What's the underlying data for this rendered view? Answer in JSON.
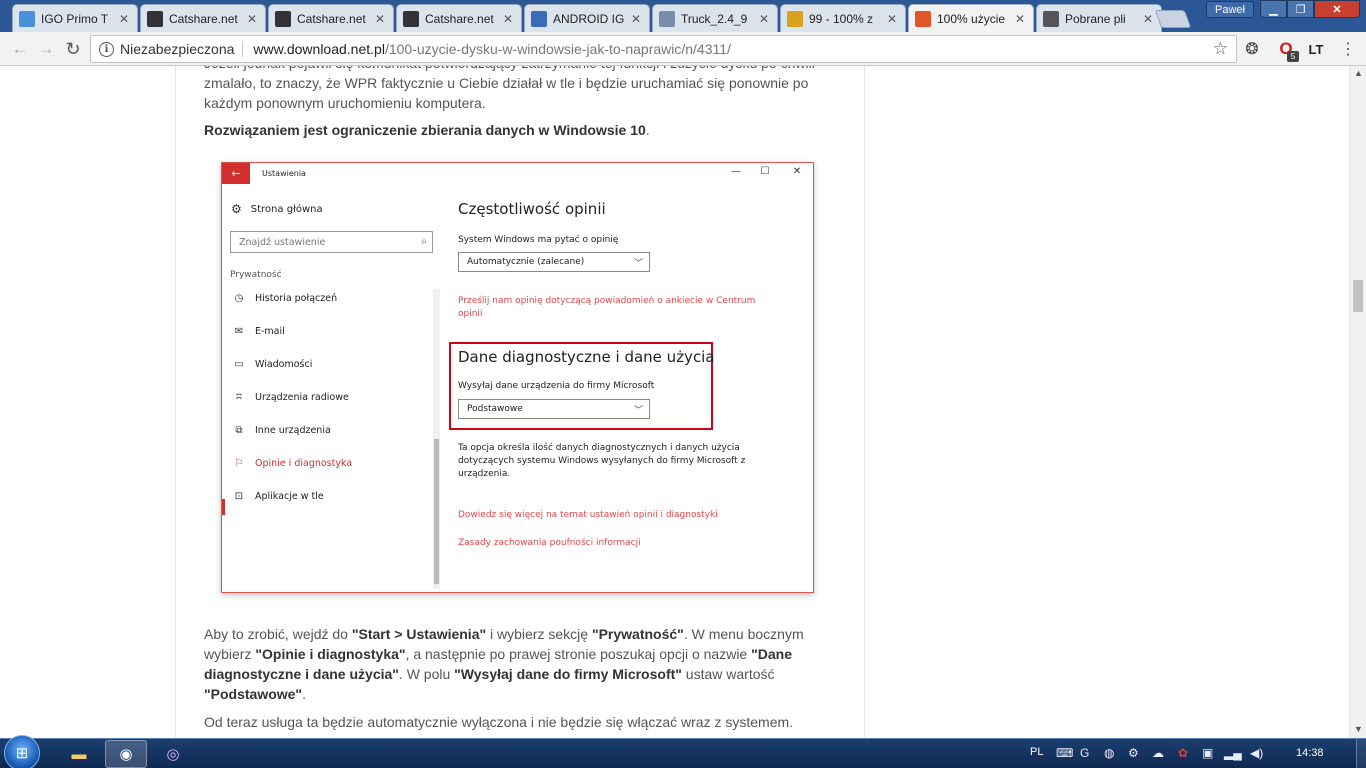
{
  "browser": {
    "tabs": [
      {
        "label": "IGO Primo T",
        "favicon": "igo-icon",
        "color": "#4a90d9"
      },
      {
        "label": "Catshare.net",
        "favicon": "cat-icon",
        "color": "#333333"
      },
      {
        "label": "Catshare.net",
        "favicon": "cat-icon",
        "color": "#333333"
      },
      {
        "label": "Catshare.net",
        "favicon": "cat-icon",
        "color": "#333333"
      },
      {
        "label": "ANDROID IG",
        "favicon": "globe-icon",
        "color": "#3b6cb7"
      },
      {
        "label": "Truck_2.4_9",
        "favicon": "doc-icon",
        "color": "#7a8da8"
      },
      {
        "label": "99 - 100% z",
        "favicon": "bulb-icon",
        "color": "#d9a21e"
      },
      {
        "label": "100% użycie",
        "favicon": "dn-icon",
        "color": "#e2552a",
        "active": true
      },
      {
        "label": "Pobrane pli",
        "favicon": "download-icon",
        "color": "#555555"
      }
    ],
    "user": "Paweł",
    "security_label": "Niezabezpieczona",
    "url_host": "www.download.net.pl",
    "url_path": "/100-uzycie-dysku-w-windowsie-jak-to-naprawic/n/4311/",
    "opera_badge": "5",
    "lt_label": "LT"
  },
  "article": {
    "para1": "Jeżeli jednak pojawił się komunikat potwierdzający zatrzymanie tej funkcji i zużycie dysku po chwili zmalało, to znaczy, że WPR faktycznie u Ciebie działał w tle i będzie uruchamiać się ponownie po każdym ponownym uruchomieniu komputera.",
    "para2": "Rozwiązaniem jest ograniczenie zbierania danych w Windowsie 10",
    "para3": [
      {
        "t": "Aby to zrobić, wejdź do ",
        "b": false
      },
      {
        "t": "\"Start > Ustawienia\"",
        "b": true
      },
      {
        "t": " i wybierz sekcję ",
        "b": false
      },
      {
        "t": "\"Prywatność\"",
        "b": true
      },
      {
        "t": ". W menu bocznym wybierz ",
        "b": false
      },
      {
        "t": "\"Opinie i diagnostyka\"",
        "b": true
      },
      {
        "t": ", a następnie po prawej stronie poszukaj opcji o nazwie ",
        "b": false
      },
      {
        "t": "\"Dane diagnostyczne i dane użycia\"",
        "b": true
      },
      {
        "t": ". W polu ",
        "b": false
      },
      {
        "t": "\"Wysyłaj dane do firmy Microsoft\"",
        "b": true
      },
      {
        "t": " ustaw wartość ",
        "b": false
      },
      {
        "t": "\"Podstawowe\"",
        "b": true
      },
      {
        "t": ".",
        "b": false
      }
    ],
    "para4": "Od teraz usługa ta będzie automatycznie wyłączona i nie będzie się włączać wraz z systemem."
  },
  "settings": {
    "title": "Ustawienia",
    "home": "Strona główna",
    "search_placeholder": "Znajdź ustawienie",
    "group": "Prywatność",
    "nav_items": [
      {
        "label": "Historia połączeń",
        "icon": "history-icon",
        "glyph": "◷"
      },
      {
        "label": "E-mail",
        "icon": "mail-icon",
        "glyph": "✉"
      },
      {
        "label": "Wiadomości",
        "icon": "chat-icon",
        "glyph": "▭"
      },
      {
        "label": "Urządzenia radiowe",
        "icon": "radio-icon",
        "glyph": "ʭ"
      },
      {
        "label": "Inne urządzenia",
        "icon": "devices-icon",
        "glyph": "⧉"
      },
      {
        "label": "Opinie i diagnostyka",
        "icon": "feedback-icon",
        "glyph": "⚐",
        "active": true
      },
      {
        "label": "Aplikacje w tle",
        "icon": "apps-icon",
        "glyph": "⊡"
      }
    ],
    "freq_heading": "Częstotliwość opinii",
    "freq_label": "System Windows ma pytać o opinię",
    "freq_value": "Automatycznie (zalecane)",
    "feedback_link": "Prześlij nam opinię dotyczącą powiadomień o ankiecie w Centrum opinii",
    "diag_heading": "Dane diagnostyczne i dane użycia",
    "diag_label": "Wysyłaj dane urządzenia do firmy Microsoft",
    "diag_value": "Podstawowe",
    "diag_desc": "Ta opcja określa ilość danych diagnostycznych i danych użycia dotyczących systemu Windows wysyłanych do firmy Microsoft z urządzenia.",
    "learn_link": "Dowiedz się więcej na temat ustawień opinii i diagnostyki",
    "privacy_link": "Zasady zachowania poufności informacji",
    "accent": "#d32f2f"
  },
  "taskbar": {
    "language": "PL",
    "clock": "14:38"
  }
}
